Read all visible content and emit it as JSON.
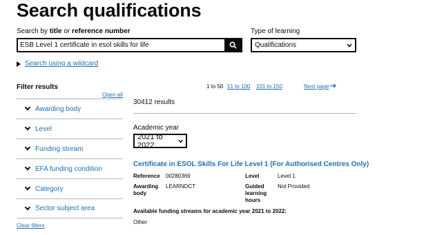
{
  "page": {
    "title": "Search qualifications"
  },
  "search": {
    "label_prefix": "Search by ",
    "label_title": "title",
    "label_or": " or ",
    "label_ref": "reference number",
    "value": "ESB Level 1 certificate in esol skills for life",
    "button_icon": "search-icon"
  },
  "type_of_learning": {
    "label": "Type of learning",
    "selected": "Qualifications"
  },
  "wildcard_link": "Search using a wildcard",
  "filters": {
    "heading": "Filter results",
    "open_all": "Open all",
    "items": [
      {
        "label": "Awarding body"
      },
      {
        "label": "Level"
      },
      {
        "label": "Funding stream"
      },
      {
        "label": "EFA funding condition"
      },
      {
        "label": "Category"
      },
      {
        "label": "Sector subject area"
      }
    ],
    "clear": "Clear filters"
  },
  "pagination": {
    "current": "1 to 50",
    "links": [
      "51 to 100",
      "101 to 150"
    ],
    "next": "Next page"
  },
  "results": {
    "count": "30412 results",
    "academic_year": {
      "label": "Academic year",
      "selected": "2021 to 2022"
    },
    "item": {
      "title": "Certificate in ESOL Skills For Life Level 1 (For Authorised Centres Only)",
      "reference_key": "Reference",
      "reference_value": "00280369",
      "awarding_key": "Awarding body",
      "awarding_value": "LEARNDCT",
      "level_key": "Level",
      "level_value": "Level 1",
      "glh_key": "Guided learning hours",
      "glh_value": "Not Provided",
      "funding_heading": "Available funding streams for academic year 2021 to 2022:",
      "funding_value": "Other"
    }
  },
  "colors": {
    "link": "#1d70b8",
    "text": "#0b0c0c",
    "border": "#b1b4b6"
  }
}
